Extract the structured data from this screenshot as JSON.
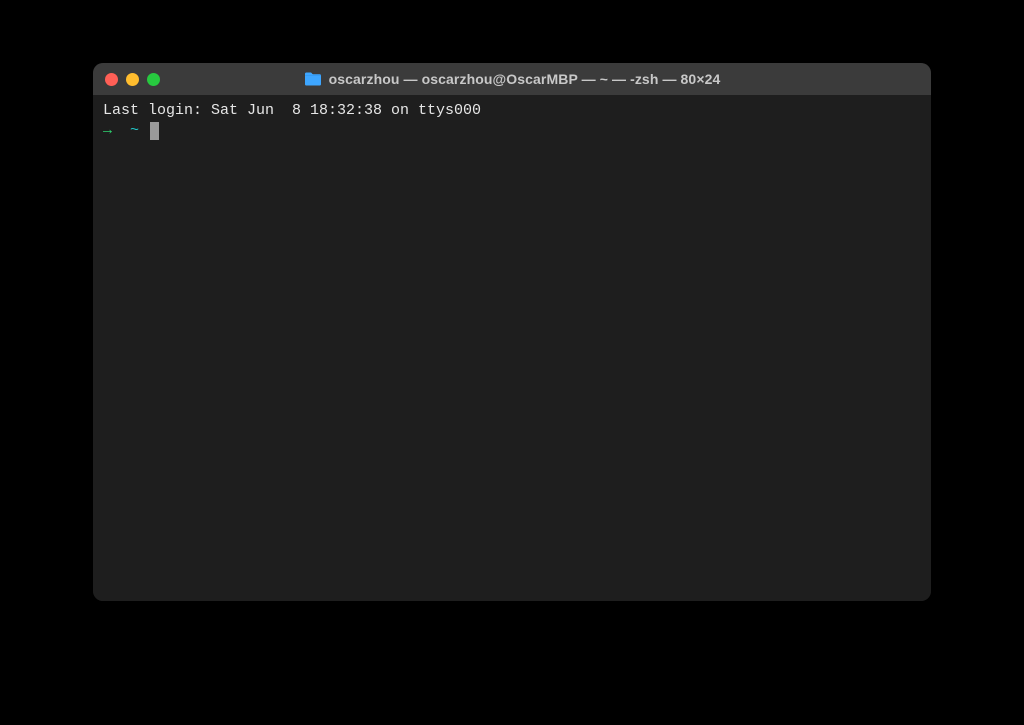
{
  "window": {
    "title": "oscarzhou — oscarzhou@OscarMBP — ~ — -zsh — 80×24",
    "folder_icon": "folder-icon"
  },
  "terminal": {
    "last_login": "Last login: Sat Jun  8 18:32:38 on ttys000",
    "prompt_arrow": "→",
    "prompt_cwd": "~"
  },
  "colors": {
    "background": "#1e1e1e",
    "titlebar": "#3b3b3b",
    "close": "#ff5f56",
    "minimize": "#ffbd2e",
    "maximize": "#27c93f",
    "prompt_arrow": "#2dd36f",
    "prompt_cwd": "#21c7c7",
    "cursor": "#9a9a9a"
  }
}
